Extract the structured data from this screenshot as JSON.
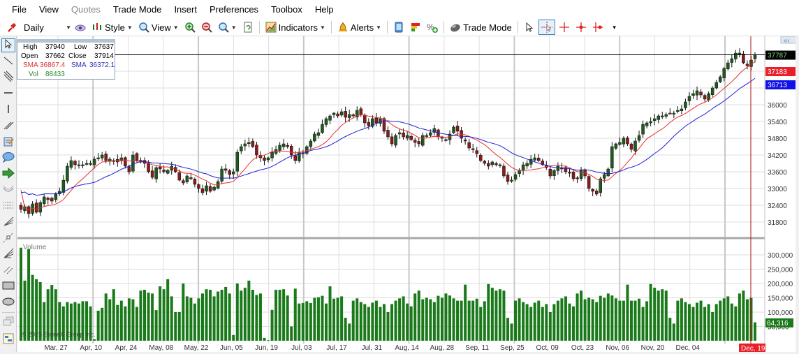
{
  "menubar": {
    "items": [
      {
        "label": "File",
        "enabled": true
      },
      {
        "label": "View",
        "enabled": true
      },
      {
        "label": "Quotes",
        "enabled": false
      },
      {
        "label": "Trade Mode",
        "enabled": true
      },
      {
        "label": "Insert",
        "enabled": true
      },
      {
        "label": "Preferences",
        "enabled": true
      },
      {
        "label": "Toolbox",
        "enabled": true
      },
      {
        "label": "Help",
        "enabled": true
      }
    ]
  },
  "toolbar": {
    "period": "Daily",
    "style_label": "Style",
    "view_label": "View",
    "indicators_label": "Indicators",
    "alerts_label": "Alerts",
    "trade_mode_label": "Trade Mode"
  },
  "info_box": {
    "high_label": "High",
    "high": "37940",
    "low_label": "Low",
    "low": "37637",
    "open_label": "Open",
    "open": "37662",
    "close_label": "Close",
    "close": "37914",
    "sma1_label": "SMA",
    "sma1": "36867.4",
    "sma2_label": "SMA",
    "sma2": "36372.1",
    "vol_label": "Vol",
    "vol": "88433"
  },
  "colors": {
    "up_candle": "#1e5a1e",
    "down_candle": "#8b1a1a",
    "sma_fast": "#e8302e",
    "sma_slow": "#2020d0",
    "volume_bar": "#1a7a1a",
    "crosshair": "#b01010",
    "last_price_bg": "#000000",
    "last_price_fg": "#7cd07c"
  },
  "price_labels": {
    "last": "37787",
    "sma_fast": "37183",
    "sma_slow": "36713"
  },
  "volume_label": "Volume",
  "last_volume_label": "64,316",
  "crosshair_date_label": "Dec, 19",
  "copyright": "© 2023 StoneX Group Inc.",
  "chart_data": [
    {
      "type": "candlestick",
      "title": "",
      "ylim": [
        31400,
        38500
      ],
      "y_ticks": [
        31800,
        32400,
        33000,
        33600,
        34200,
        34800,
        35400,
        36000
      ],
      "x_ticks": [
        "Mar, 27",
        "Apr, 10",
        "Apr, 24",
        "May, 08",
        "May, 22",
        "Jun, 05",
        "Jun, 19",
        "Jul, 03",
        "Jul, 17",
        "Jul, 31",
        "Aug, 14",
        "Aug, 28",
        "Sep, 11",
        "Sep, 25",
        "Oct, 09",
        "Oct, 23",
        "Nov, 06",
        "Nov, 20",
        "Dec, 04",
        "Dec, 19"
      ],
      "closes": [
        32250,
        32350,
        32100,
        32450,
        32150,
        32500,
        32700,
        32600,
        32550,
        32800,
        32900,
        33300,
        33800,
        34000,
        33850,
        33850,
        33850,
        33900,
        33900,
        34050,
        34100,
        34200,
        34000,
        34050,
        34000,
        33950,
        34100,
        33800,
        33600,
        34200,
        34000,
        33950,
        33900,
        33600,
        33400,
        33750,
        33700,
        33600,
        33650,
        33800,
        33600,
        33300,
        33200,
        33450,
        33350,
        33150,
        33000,
        32850,
        33100,
        32900,
        33050,
        33250,
        33700,
        33650,
        33500,
        33600,
        34300,
        34500,
        34600,
        34650,
        34500,
        34200,
        34100,
        34000,
        34100,
        34300,
        34400,
        34550,
        34600,
        34500,
        34200,
        34000,
        34300,
        34250,
        34500,
        34700,
        34950,
        35000,
        35300,
        35500,
        35600,
        35700,
        35600,
        35750,
        35550,
        35650,
        35600,
        35800,
        35650,
        35350,
        35250,
        35500,
        35350,
        35500,
        35050,
        34850,
        34600,
        34900,
        35000,
        34850,
        34900,
        34750,
        34650,
        34600,
        34900,
        34900,
        35000,
        35150,
        34850,
        34800,
        34750,
        34950,
        35200,
        35050,
        34800,
        34700,
        34450,
        34400,
        34250,
        34000,
        33900,
        33800,
        33950,
        33850,
        33850,
        33450,
        33250,
        33300,
        33500,
        33650,
        33850,
        33900,
        34050,
        34100,
        34000,
        33850,
        33750,
        33450,
        33650,
        33800,
        33700,
        33600,
        33550,
        33350,
        33350,
        33650,
        33450,
        33000,
        32900,
        32800,
        33350,
        33500,
        33700,
        34500,
        34600,
        34650,
        34800,
        34600,
        34400,
        34700,
        34900,
        35300,
        35350,
        35400,
        35500,
        35600,
        35600,
        35650,
        35700,
        35700,
        35800,
        35850,
        36100,
        36300,
        36400,
        36500,
        36350,
        36200,
        36400,
        36600,
        36800,
        37000,
        37300,
        37500,
        37650,
        37850,
        37850,
        37500,
        37400,
        37600,
        37787
      ],
      "sma_fast_end": 37183,
      "sma_slow_end": 36713,
      "last": 37787
    },
    {
      "type": "bar",
      "title": "Volume",
      "ylim": [
        0,
        350000
      ],
      "y_ticks": [
        50000,
        100000,
        150000,
        200000,
        250000,
        300000
      ],
      "values": [
        325000,
        210000,
        320000,
        230000,
        215000,
        205000,
        135000,
        180000,
        195000,
        180000,
        135000,
        120000,
        135000,
        130000,
        135000,
        130000,
        138000,
        138000,
        120000,
        5000,
        105000,
        115000,
        165000,
        145000,
        180000,
        125000,
        140000,
        120000,
        148000,
        145000,
        118000,
        175000,
        178000,
        168000,
        165000,
        107000,
        190000,
        180000,
        215000,
        155000,
        100000,
        100000,
        200000,
        155000,
        150000,
        130000,
        148000,
        165000,
        180000,
        178000,
        155000,
        172000,
        178000,
        188000,
        165000,
        20000,
        200000,
        175000,
        185000,
        210000,
        178000,
        160000,
        165000,
        10000,
        2000,
        108000,
        178000,
        178000,
        180000,
        158000,
        50000,
        182000,
        130000,
        132000,
        138000,
        132000,
        150000,
        152000,
        157000,
        130000,
        190000,
        147000,
        150000,
        155000,
        80000,
        60000,
        140000,
        148000,
        135000,
        128000,
        118000,
        133000,
        140000,
        118000,
        128000,
        100000,
        128000,
        140000,
        148000,
        155000,
        130000,
        120000,
        165000,
        175000,
        145000,
        150000,
        145000,
        135000,
        157000,
        150000,
        165000,
        158000,
        148000,
        140000,
        140000,
        196000,
        140000,
        140000,
        147000,
        118000,
        138000,
        198000,
        185000,
        175000,
        180000,
        175000,
        80000,
        60000,
        140000,
        148000,
        135000,
        128000,
        118000,
        133000,
        140000,
        118000,
        128000,
        100000,
        128000,
        140000,
        148000,
        155000,
        130000,
        120000,
        165000,
        175000,
        145000,
        150000,
        145000,
        135000,
        157000,
        150000,
        165000,
        158000,
        148000,
        140000,
        140000,
        196000,
        140000,
        140000,
        147000,
        118000,
        138000,
        198000,
        185000,
        175000,
        180000,
        175000,
        80000,
        60000,
        140000,
        148000,
        135000,
        128000,
        118000,
        133000,
        140000,
        118000,
        128000,
        100000,
        128000,
        140000,
        148000,
        155000,
        130000,
        120000,
        165000,
        175000,
        145000,
        150000,
        145000,
        135000,
        157000,
        150000,
        165000,
        158000,
        148000,
        140000,
        140000
      ],
      "last_value": 64316
    }
  ]
}
